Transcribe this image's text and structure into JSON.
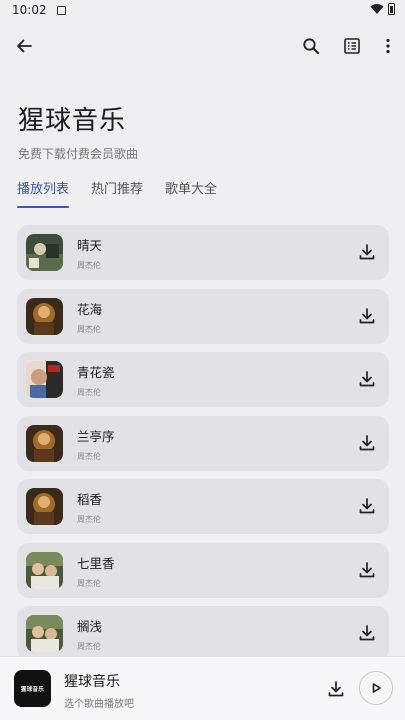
{
  "status": {
    "time": "10:02"
  },
  "app": {
    "title": "猩球音乐",
    "subtitle": "免费下载付费会员歌曲"
  },
  "tabs": [
    {
      "label": "播放列表",
      "active": true
    },
    {
      "label": "热门推荐",
      "active": false
    },
    {
      "label": "歌单大全",
      "active": false
    }
  ],
  "songs": [
    {
      "name": "晴天",
      "artist": "周杰伦"
    },
    {
      "name": "花海",
      "artist": "周杰伦"
    },
    {
      "name": "青花瓷",
      "artist": "周杰伦"
    },
    {
      "name": "兰亭序",
      "artist": "周杰伦"
    },
    {
      "name": "稻香",
      "artist": "周杰伦"
    },
    {
      "name": "七里香",
      "artist": "周杰伦"
    },
    {
      "name": "搁浅",
      "artist": "周杰伦"
    }
  ],
  "player": {
    "title": "猩球音乐",
    "subtitle": "选个歌曲播放吧",
    "cover_text": "猩球音乐"
  },
  "colors": {
    "accent": "#3a5aa8",
    "card": "#e2e2e6",
    "background": "#efeff1"
  }
}
